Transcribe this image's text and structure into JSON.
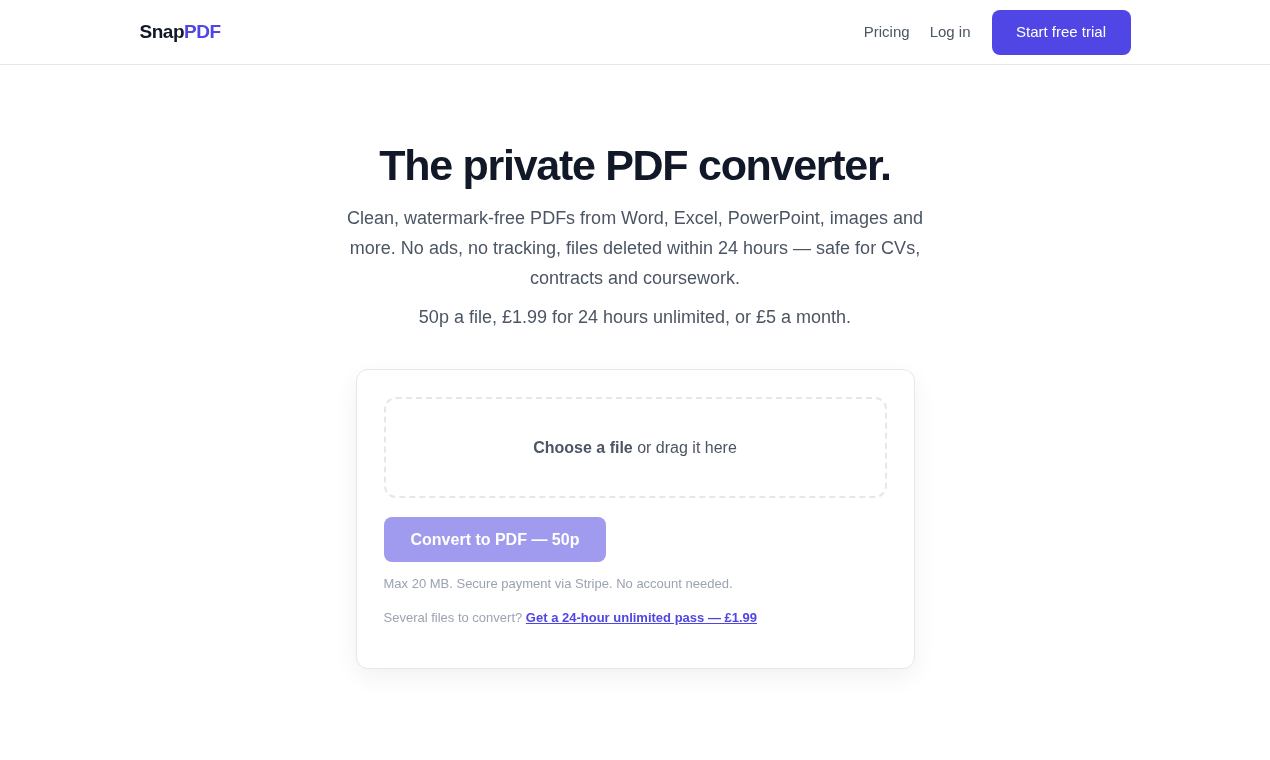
{
  "header": {
    "logo": {
      "text": "Snap",
      "accent": "PDF"
    },
    "nav_links": [
      "Pricing",
      "Log in"
    ],
    "cta_button": "Start free trial"
  },
  "hero": {
    "title": "The private PDF converter.",
    "description": "Clean, watermark-free PDFs from Word, Excel, PowerPoint, images and more. No ads, no tracking, files deleted within 24 hours — safe for CVs, contracts and coursework.",
    "pricing": "50p a file, £1.99 for 24 hours unlimited, or £5 a month."
  },
  "upload_card": {
    "dropzone": {
      "label": "**Choose a file** or drag it here"
    },
    "convert_button": {
      "label": "Convert to PDF — 50p",
      "disabled": true
    },
    "note": "Max 20 MB. Secure payment via Stripe. No account needed.",
    "upsell": {
      "text": "Several files to convert?",
      "link": "Get a 24-hour unlimited pass — £1.99"
    }
  }
}
